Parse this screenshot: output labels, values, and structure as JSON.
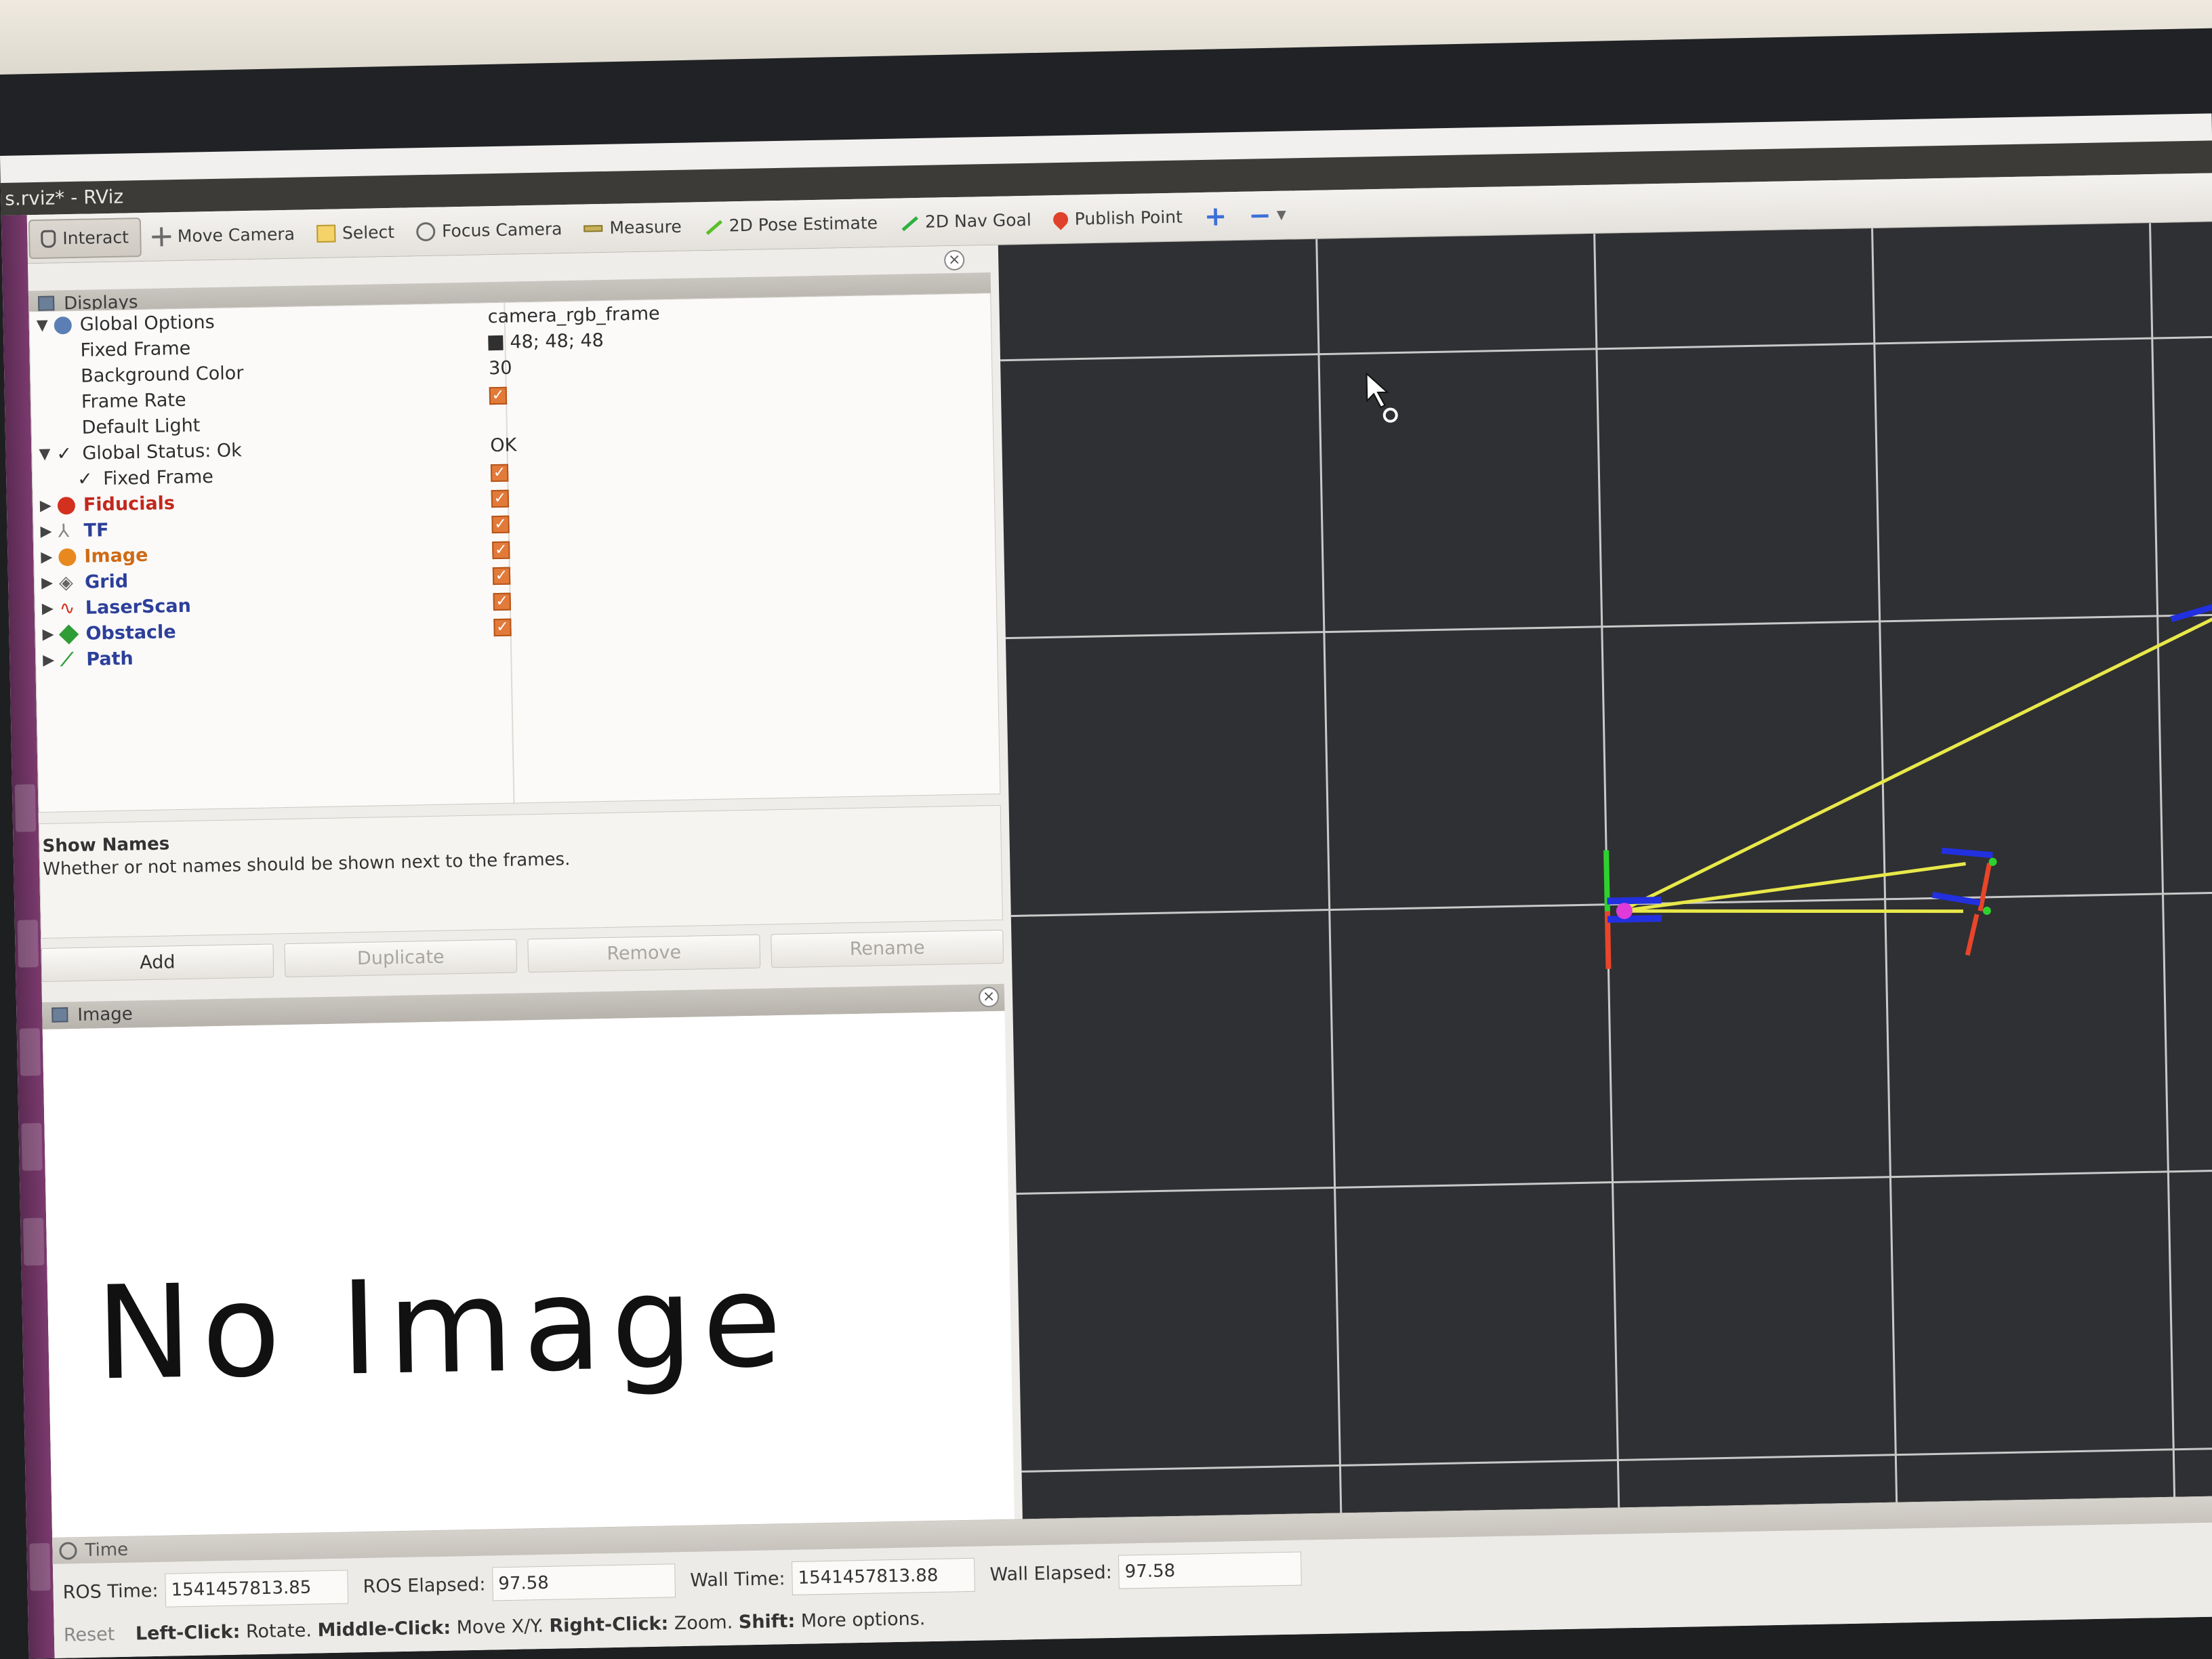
{
  "window": {
    "title": "s.rviz* - RViz"
  },
  "toolbar": {
    "interact": "Interact",
    "move_camera": "Move Camera",
    "select": "Select",
    "focus_camera": "Focus Camera",
    "measure": "Measure",
    "pose_estimate": "2D Pose Estimate",
    "nav_goal": "2D Nav Goal",
    "publish_point": "Publish Point",
    "add_tool": "+",
    "remove_tool": "−"
  },
  "displays": {
    "header": "Displays",
    "global_options": "Global Options",
    "fixed_frame_label": "Fixed Frame",
    "fixed_frame_value": "camera_rgb_frame",
    "background_color_label": "Background Color",
    "background_color_value": "48; 48; 48",
    "background_color_hex": "#303030",
    "frame_rate_label": "Frame Rate",
    "frame_rate_value": "30",
    "default_light_label": "Default Light",
    "global_status_label": "Global Status: Ok",
    "global_status_value": "OK",
    "status_fixed_frame": "Fixed Frame",
    "items": [
      {
        "label": "Fiducials",
        "style": "red",
        "checked": true
      },
      {
        "label": "TF",
        "style": "blue",
        "checked": true
      },
      {
        "label": "Image",
        "style": "orange",
        "checked": true
      },
      {
        "label": "Grid",
        "style": "blue",
        "checked": true
      },
      {
        "label": "LaserScan",
        "style": "blue",
        "checked": true
      },
      {
        "label": "Obstacle",
        "style": "blue",
        "checked": true
      },
      {
        "label": "Path",
        "style": "blue",
        "checked": true
      }
    ]
  },
  "description": {
    "title": "Show Names",
    "text": "Whether or not names should be shown next to the frames."
  },
  "buttons": {
    "add": "Add",
    "duplicate": "Duplicate",
    "remove": "Remove",
    "rename": "Rename"
  },
  "image_panel": {
    "header": "Image",
    "placeholder": "No Image"
  },
  "time": {
    "header": "Time",
    "ros_time_label": "ROS Time:",
    "ros_time": "1541457813.85",
    "ros_elapsed_label": "ROS Elapsed:",
    "ros_elapsed": "97.58",
    "wall_time_label": "Wall Time:",
    "wall_time": "1541457813.88",
    "wall_elapsed_label": "Wall Elapsed:",
    "wall_elapsed": "97.58"
  },
  "statusbar": {
    "reset": "Reset",
    "left_click": "Left-Click:",
    "left_action": "Rotate.",
    "middle_click": "Middle-Click:",
    "middle_action": "Move X/Y.",
    "right_click": "Right-Click:",
    "right_action": "Zoom.",
    "shift": "Shift:",
    "shift_action": "More options."
  },
  "colors": {
    "viewport_bg": "#2f3033",
    "grid_line": "#c9c9c9",
    "ray": "#e8e84a",
    "axis_x": "#e8452a",
    "axis_y": "#2ed12e",
    "axis_z": "#2230e0"
  }
}
